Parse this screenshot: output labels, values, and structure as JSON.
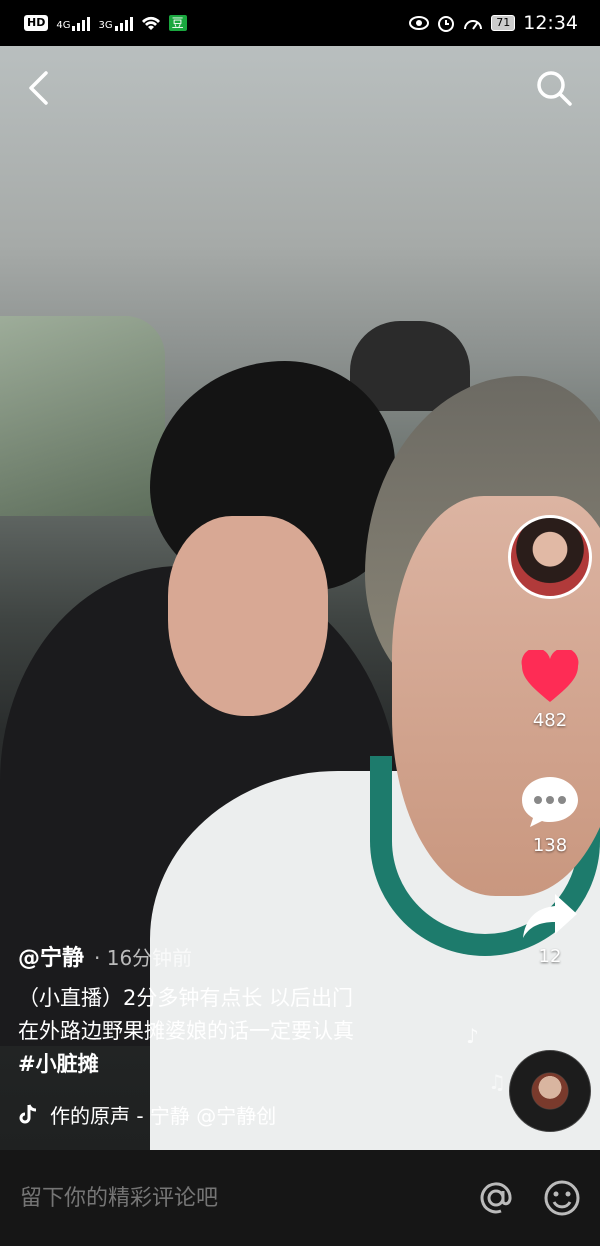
{
  "status_bar": {
    "hd": "HD",
    "net1": "4G",
    "net2": "3G",
    "app_badge": "豆",
    "battery": "71",
    "time": "12:34"
  },
  "video": {
    "likes": "482",
    "comments": "138",
    "shares": "12"
  },
  "post": {
    "author": "@宁静",
    "time_ago": "· 16分钟前",
    "caption_line1": "（小直播）2分多钟有点长  以后出门",
    "caption_line2": "在外路边野果摊婆娘的话一定要认真",
    "hashtag": "#小脏摊",
    "music_text": "作的原声 - 宁静    @宁静创"
  },
  "comment_bar": {
    "placeholder": "留下你的精彩评论吧"
  },
  "colors": {
    "heart": "#fe2c55",
    "badge_green": "#1aa73f"
  },
  "icons": [
    "back-icon",
    "search-icon",
    "heart-icon",
    "comment-icon",
    "share-icon",
    "music-note-icon",
    "at-icon",
    "emoji-icon"
  ]
}
